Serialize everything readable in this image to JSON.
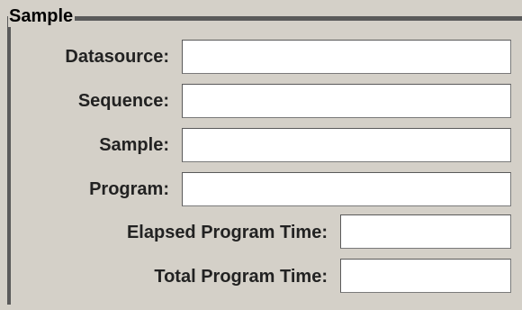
{
  "group": {
    "title": "Sample"
  },
  "fields": {
    "datasource": {
      "label": "Datasource:",
      "value": ""
    },
    "sequence": {
      "label": "Sequence:",
      "value": ""
    },
    "sample": {
      "label": "Sample:",
      "value": ""
    },
    "program": {
      "label": "Program:",
      "value": ""
    },
    "elapsed_program_time": {
      "label": "Elapsed Program Time:",
      "value": ""
    },
    "total_program_time": {
      "label": "Total Program Time:",
      "value": ""
    }
  }
}
